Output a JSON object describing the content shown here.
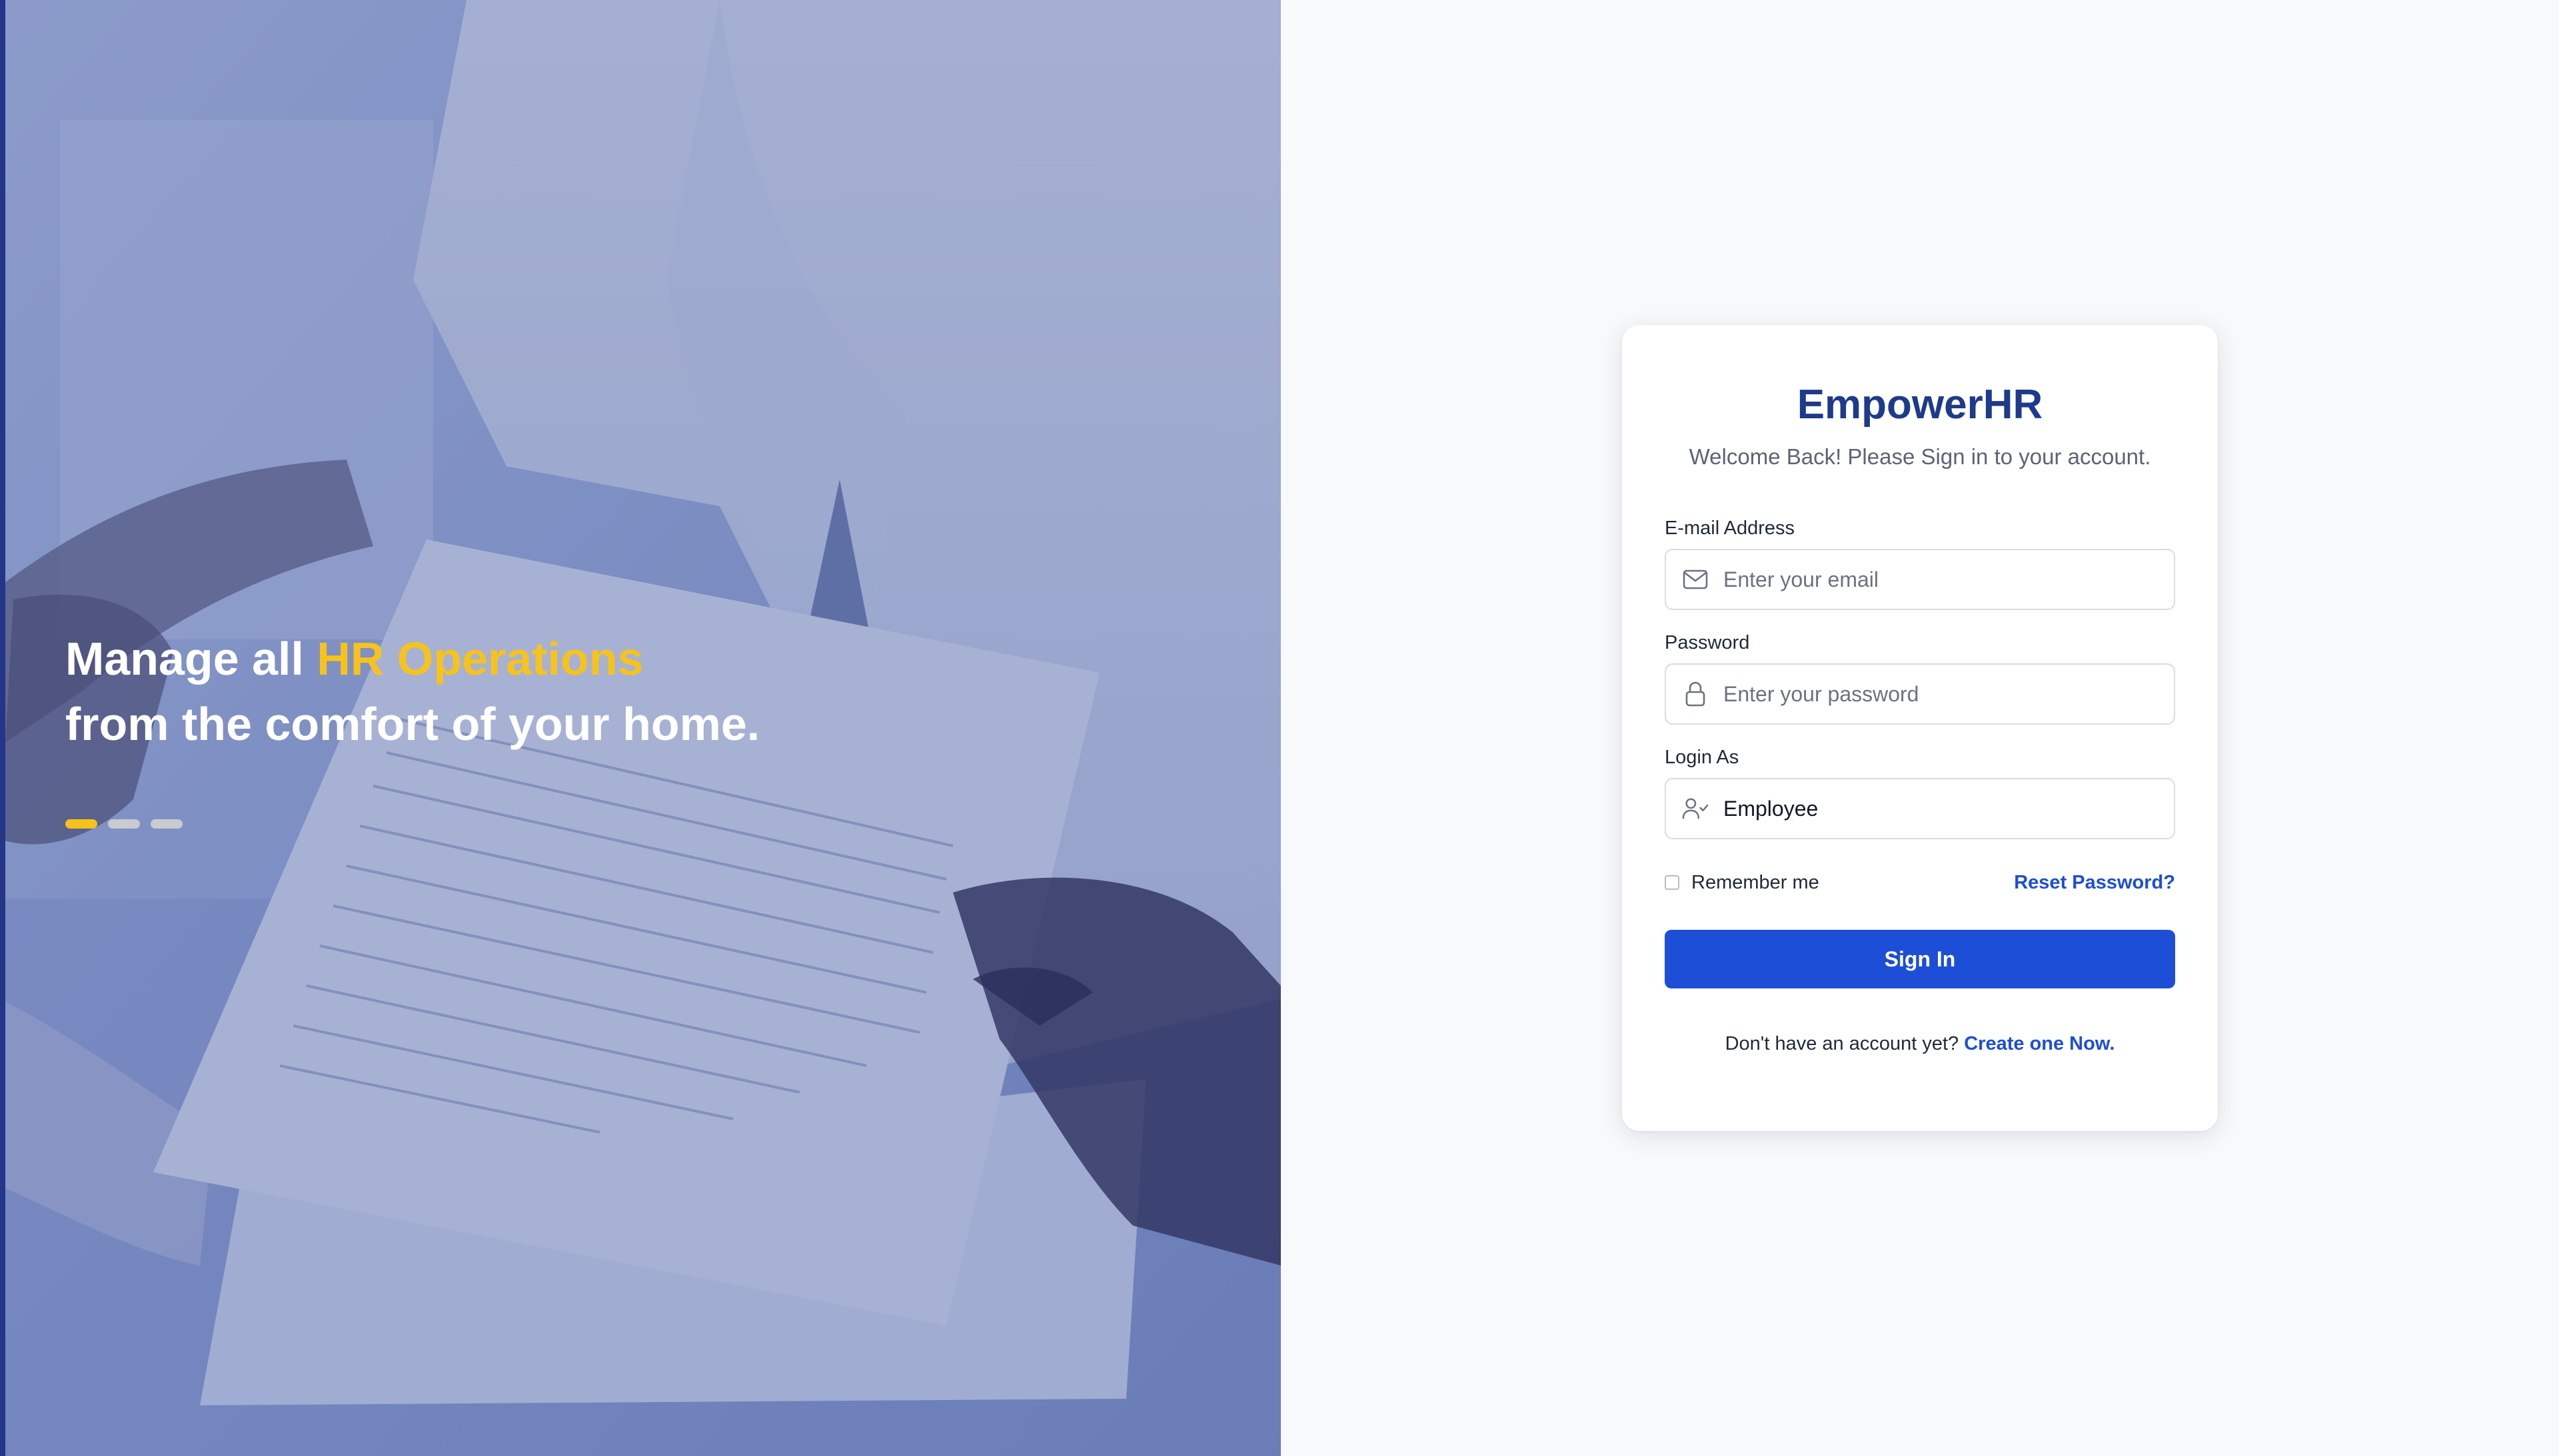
{
  "hero": {
    "headline_prefix": "Manage all ",
    "headline_accent": "HR Operations",
    "headline_line2": "from the comfort of your home.",
    "carousel_dots": 3,
    "carousel_active_index": 0,
    "accent_color": "#f7c31b"
  },
  "card": {
    "brand": "EmpowerHR",
    "welcome": "Welcome Back! Please Sign in to your account.",
    "email": {
      "label": "E-mail Address",
      "placeholder": "Enter your email",
      "value": "",
      "icon": "mail-icon"
    },
    "password": {
      "label": "Password",
      "placeholder": "Enter your password",
      "value": "",
      "icon": "lock-icon"
    },
    "login_as": {
      "label": "Login As",
      "value": "Employee",
      "icon": "user-check-icon"
    },
    "remember_label": "Remember me",
    "remember_checked": false,
    "reset_link": "Reset Password?",
    "signin_label": "Sign In",
    "signup_prompt": "Don't have an account yet?",
    "signup_link": "Create one Now."
  },
  "colors": {
    "brand": "#1e3a8a",
    "primary": "#1d4ed8",
    "page_bg": "#f8f9fb"
  }
}
